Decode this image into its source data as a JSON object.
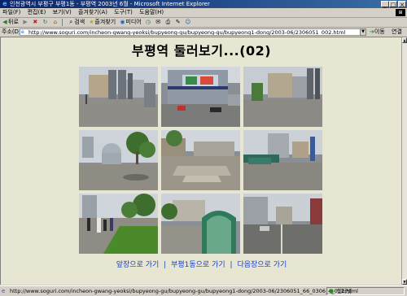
{
  "window": {
    "title": "인천광역시 부평구 부평1동 - 부평역 2003년 6월 - Microsoft Internet Explorer",
    "min_glyph": "_",
    "max_glyph": "□",
    "close_glyph": "×"
  },
  "menubar": {
    "items": [
      "파일(F)",
      "편집(E)",
      "보기(V)",
      "즐겨찾기(A)",
      "도구(T)",
      "도움말(H)"
    ]
  },
  "toolbar": {
    "back_label": "뒤로",
    "search_label": "검색",
    "favorites_label": "즐겨찾기",
    "media_label": "미디어"
  },
  "address": {
    "label": "주소(D)",
    "url": "http://www.soguri.com/incheon-gwang-yeoksi/bupyeong-gu/bupyeong-gu/bupyeong1-dong/2003-06/2306051_002.html",
    "go_label": "이동",
    "links_label": "연결"
  },
  "page": {
    "title": "부평역 둘러보기...(02)",
    "photos": [
      {
        "scene": "plaza-gate"
      },
      {
        "scene": "station-building"
      },
      {
        "scene": "plaza-gate-wide"
      },
      {
        "scene": "trees-building"
      },
      {
        "scene": "plaza-steps"
      },
      {
        "scene": "street-bus"
      },
      {
        "scene": "people-walkway"
      },
      {
        "scene": "subway-entrance"
      },
      {
        "scene": "road-street"
      }
    ],
    "nav": {
      "prev": "앞장으로 가기",
      "home": "부평1동으로 가기",
      "next": "다음장으로 가기",
      "separator": "|"
    }
  },
  "statusbar": {
    "text": "http://www.soguri.com/incheon-gwang-yeoksi/bupyeong-gu/bupyeong-gu/bupyeong1-dong/2003-06/2306051_66_0306_4_012.html",
    "zone": "인터넷"
  }
}
